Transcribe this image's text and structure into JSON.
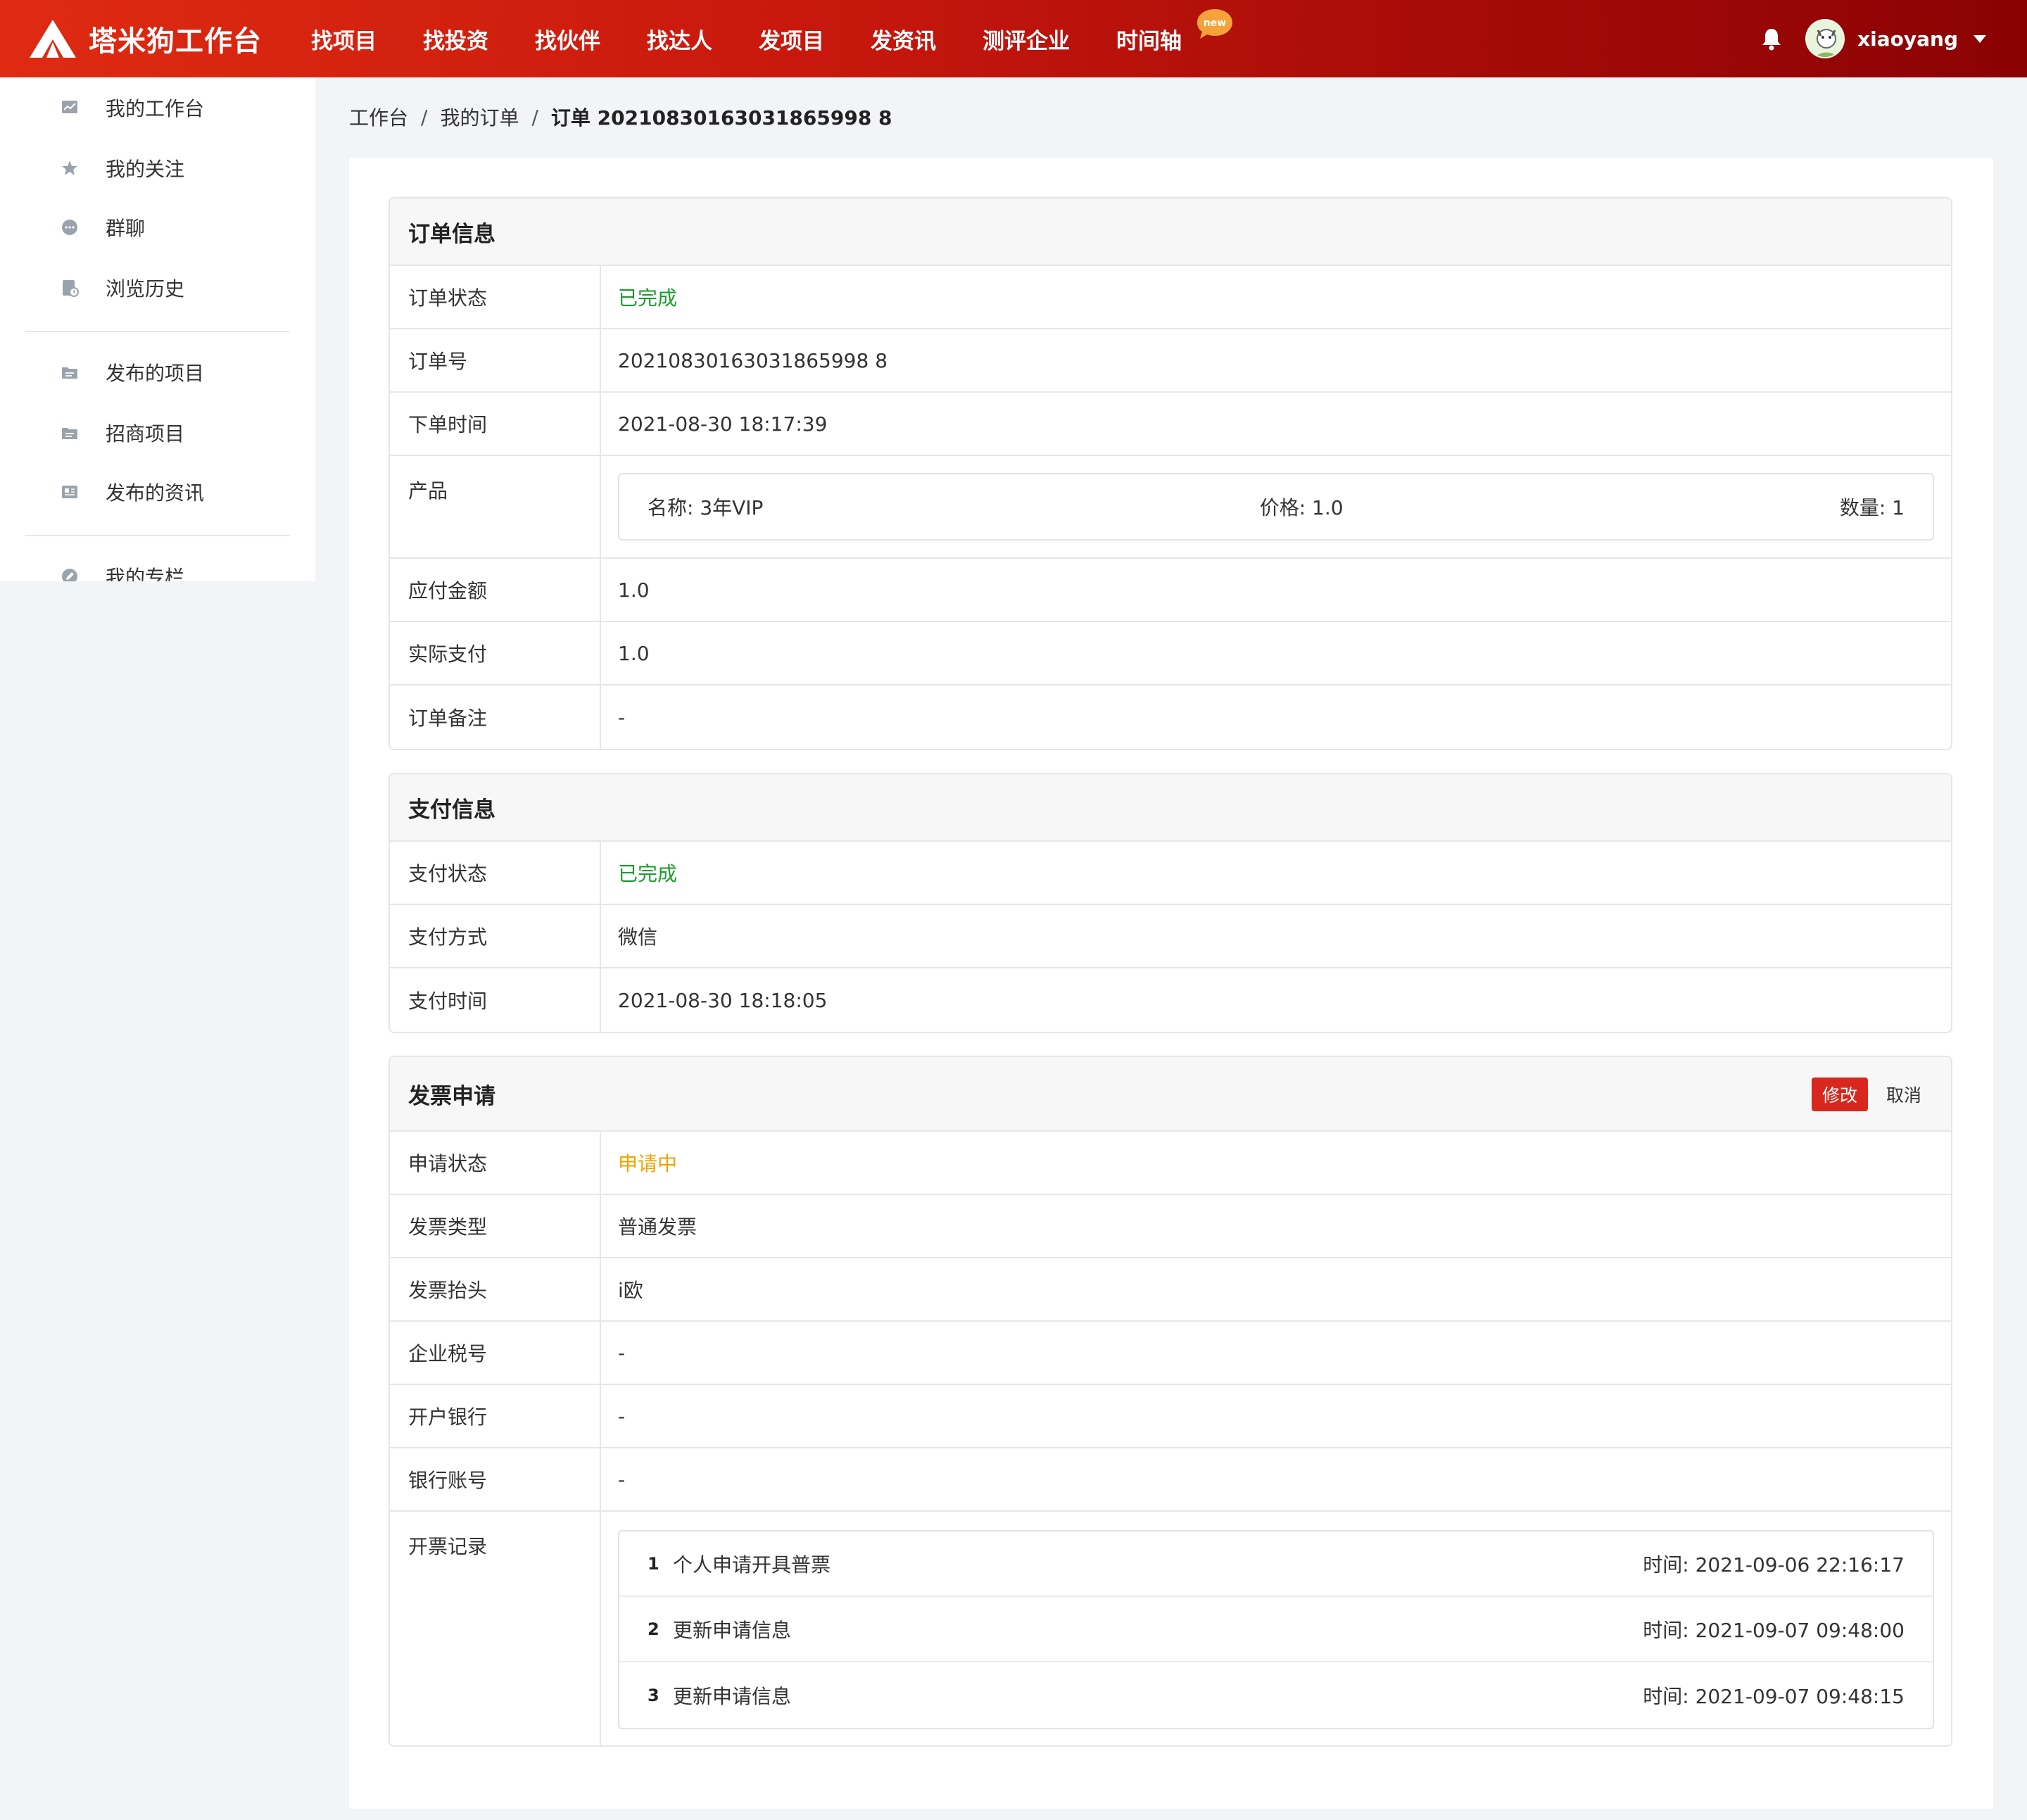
{
  "header": {
    "brand": "塔米狗工作台",
    "nav": [
      "找项目",
      "找投资",
      "找伙伴",
      "找达人",
      "发项目",
      "发资讯",
      "测评企业",
      "时间轴"
    ],
    "badge": "new",
    "username": "xiaoyang"
  },
  "sidebar": {
    "items": [
      {
        "label": "我的工作台",
        "icon": "chart-icon"
      },
      {
        "label": "我的关注",
        "icon": "star-icon"
      },
      {
        "label": "群聊",
        "icon": "chat-icon"
      },
      {
        "label": "浏览历史",
        "icon": "history-icon"
      },
      {
        "label": "发布的项目",
        "icon": "folder-icon"
      },
      {
        "label": "招商项目",
        "icon": "folder-icon"
      },
      {
        "label": "发布的资讯",
        "icon": "news-icon"
      },
      {
        "label": "我的专栏",
        "icon": "pen-icon"
      }
    ]
  },
  "breadcrumb": {
    "home": "工作台",
    "orders": "我的订单",
    "current": "订单 20210830163031865998 8"
  },
  "order": {
    "title": "订单信息",
    "status_label": "订单状态",
    "status": "已完成",
    "no_label": "订单号",
    "no": "20210830163031865998 8",
    "time_label": "下单时间",
    "time": "2021-08-30 18:17:39",
    "product_label": "产品",
    "product_name": "名称: 3年VIP",
    "product_price": "价格: 1.0",
    "product_qty": "数量: 1",
    "payable_label": "应付金额",
    "payable": "1.0",
    "paid_label": "实际支付",
    "paid": "1.0",
    "remark_label": "订单备注",
    "remark": "-"
  },
  "payment": {
    "title": "支付信息",
    "status_label": "支付状态",
    "status": "已完成",
    "method_label": "支付方式",
    "method": "微信",
    "time_label": "支付时间",
    "time": "2021-08-30 18:18:05"
  },
  "invoice": {
    "title": "发票申请",
    "edit": "修改",
    "cancel": "取消",
    "status_label": "申请状态",
    "status": "申请中",
    "type_label": "发票类型",
    "type": "普通发票",
    "header_label": "发票抬头",
    "header": "i欧",
    "tax_label": "企业税号",
    "tax": "-",
    "bank_label": "开户银行",
    "bank": "-",
    "account_label": "银行账号",
    "account": "-",
    "records_label": "开票记录",
    "records": [
      {
        "num": "1",
        "text": "个人申请开具普票",
        "time": "时间: 2021-09-06 22:16:17"
      },
      {
        "num": "2",
        "text": "更新申请信息",
        "time": "时间: 2021-09-07 09:48:00"
      },
      {
        "num": "3",
        "text": "更新申请信息",
        "time": "时间: 2021-09-07 09:48:15"
      }
    ]
  },
  "colors": {
    "accent": "#d8281e",
    "success": "#1a9b2e",
    "pending": "#f0a202"
  }
}
